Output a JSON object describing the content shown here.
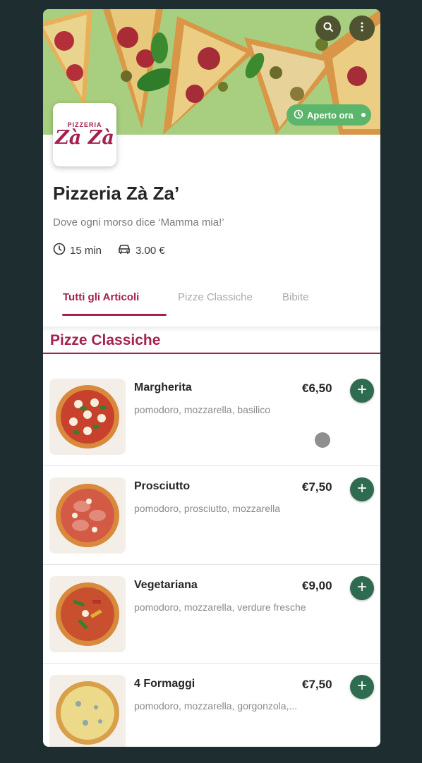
{
  "header": {
    "status_badge": "Aperto ora",
    "icons": [
      "search-icon",
      "more-vertical-icon",
      "clock-icon"
    ]
  },
  "restaurant": {
    "logo_line1": "PIZZERIA",
    "logo_line2": "Zà Zà",
    "name": "Pizzeria Zà Za’",
    "tagline": "Dove ogni morso dice ‘Mamma mia!’",
    "delivery_time": "15 min",
    "delivery_fee": "3.00 €"
  },
  "tabs": [
    {
      "label": "Tutti gli Articoli",
      "active": true
    },
    {
      "label": "Pizze Classiche",
      "active": false
    },
    {
      "label": "Bibite",
      "active": false
    }
  ],
  "section": {
    "title": "Pizze Classiche"
  },
  "items": [
    {
      "name": "Margherita",
      "description": "pomodoro, mozzarella, basilico",
      "price": "€6,50"
    },
    {
      "name": "Prosciutto",
      "description": "pomodoro, prosciutto, mozzarella",
      "price": "€7,50"
    },
    {
      "name": "Vegetariana",
      "description": "pomodoro, mozzarella, verdure fresche",
      "price": "€9,00"
    },
    {
      "name": "4 Formaggi",
      "description": "pomodoro, mozzarella, gorgonzola,...",
      "price": "€7,50"
    }
  ],
  "colors": {
    "accent": "#a4214f",
    "add_button": "#2e6b50",
    "open_badge": "#5bb56a",
    "background": "#1e2e30"
  }
}
